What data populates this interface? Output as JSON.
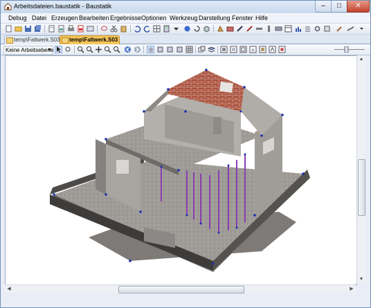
{
  "window": {
    "title": "Arbeitsdateien.baustatik - Baustatik",
    "controls": {
      "minimize": "–",
      "maximize": "□",
      "close": "✕"
    }
  },
  "menu": {
    "items": [
      {
        "label": "Debug"
      },
      {
        "label": "Datei"
      },
      {
        "label": "Erzeugen"
      },
      {
        "label": "Bearbeiten"
      },
      {
        "label": "Ergebnisse"
      },
      {
        "label": "Optionen"
      },
      {
        "label": "Werkzeug"
      },
      {
        "label": "Darstellung"
      },
      {
        "label": "Fenster"
      },
      {
        "label": "Hilfe"
      }
    ]
  },
  "tabs": [
    {
      "label": "temp\\Faltwerk.S03",
      "active": false
    },
    {
      "label": "temp\\Faltwerk.S03",
      "active": true
    }
  ],
  "toolbar2": {
    "layer_select": "Keine Arbeitsebene"
  },
  "scroll": {
    "up": "▲",
    "down": "▼",
    "left": "◀",
    "right": "▶"
  },
  "colors": {
    "window_frame": "#6d8fb5",
    "active_tab": "#f5c55b",
    "slab": "#9d9996",
    "brick": "#a04a3a",
    "node": "#1a2fb0",
    "column": "#8a3db0"
  }
}
